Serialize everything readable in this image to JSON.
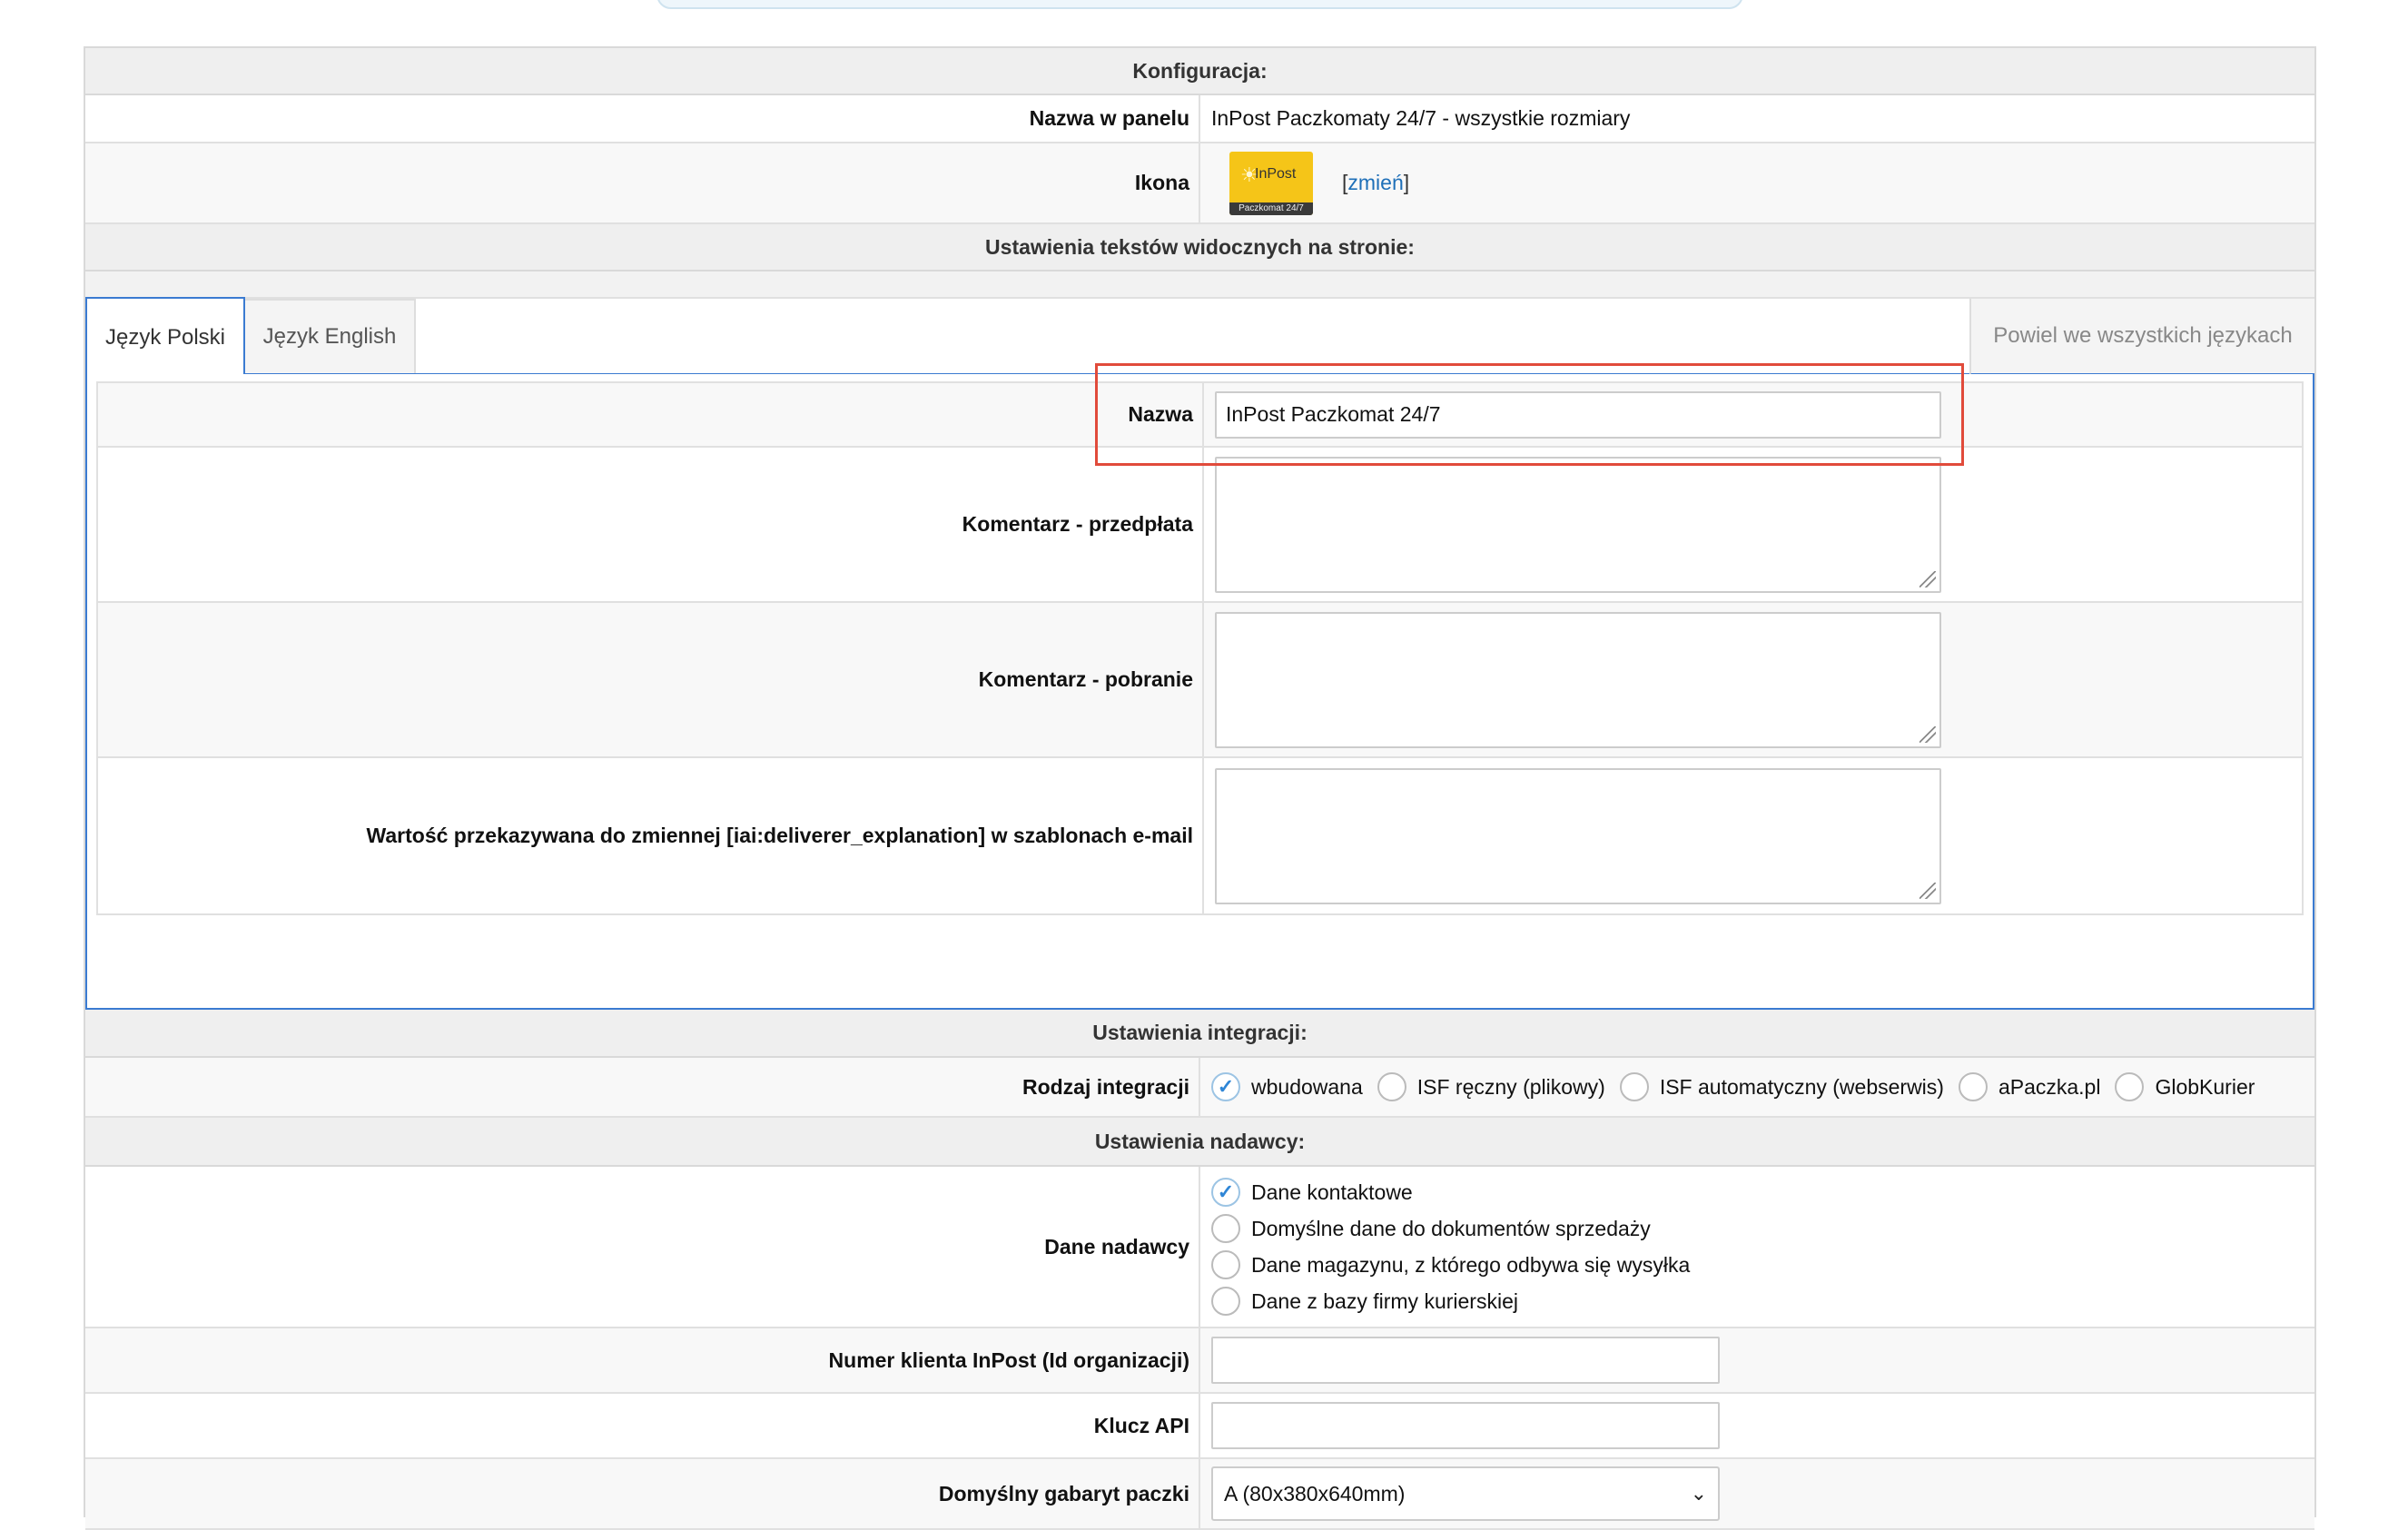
{
  "config": {
    "header": "Konfiguracja:",
    "panel_name_label": "Nazwa w panelu",
    "panel_name_value": "InPost Paczkomaty 24/7 - wszystkie rozmiary",
    "icon_label": "Ikona",
    "icon_brand_text": "InPost",
    "icon_strip_text": "Paczkomat 24/7",
    "change_link_open": "[",
    "change_link_text": "zmień",
    "change_link_close": "]"
  },
  "texts": {
    "header": "Ustawienia tekstów widocznych na stronie:",
    "tabs": [
      {
        "label": "Język Polski"
      },
      {
        "label": "Język English"
      }
    ],
    "copy_all_label": "Powiel we wszystkich językach",
    "name_label": "Nazwa",
    "name_value": "InPost Paczkomat 24/7",
    "comment_prepaid_label": "Komentarz - przedpłata",
    "comment_cod_label": "Komentarz - pobranie",
    "email_var_label": "Wartość przekazywana do zmiennej [iai:deliverer_explanation] w szablonach e-mail"
  },
  "integration": {
    "header": "Ustawienia integracji:",
    "type_label": "Rodzaj integracji",
    "options": [
      {
        "label": "wbudowana",
        "checked": true
      },
      {
        "label": "ISF ręczny (plikowy)",
        "checked": false
      },
      {
        "label": "ISF automatyczny (webserwis)",
        "checked": false
      },
      {
        "label": "aPaczka.pl",
        "checked": false
      },
      {
        "label": "GlobKurier",
        "checked": false
      }
    ]
  },
  "sender": {
    "header": "Ustawienia nadawcy:",
    "data_label": "Dane nadawcy",
    "options": [
      {
        "label": "Dane kontaktowe",
        "checked": true
      },
      {
        "label": "Domyślne dane do dokumentów sprzedaży",
        "checked": false
      },
      {
        "label": "Dane magazynu, z którego odbywa się wysyłka",
        "checked": false
      },
      {
        "label": "Dane z bazy firmy kurierskiej",
        "checked": false
      }
    ],
    "client_number_label": "Numer klienta InPost (Id organizacji)",
    "client_number_value": "",
    "api_key_label": "Klucz API",
    "api_key_value": "",
    "default_size_label": "Domyślny gabaryt paczki",
    "default_size_value": "A (80x380x640mm)"
  },
  "colors": {
    "accent": "#3b7bd1",
    "highlight": "#e14b3b",
    "link": "#1e6fb8",
    "icon_bg": "#f5c518"
  }
}
